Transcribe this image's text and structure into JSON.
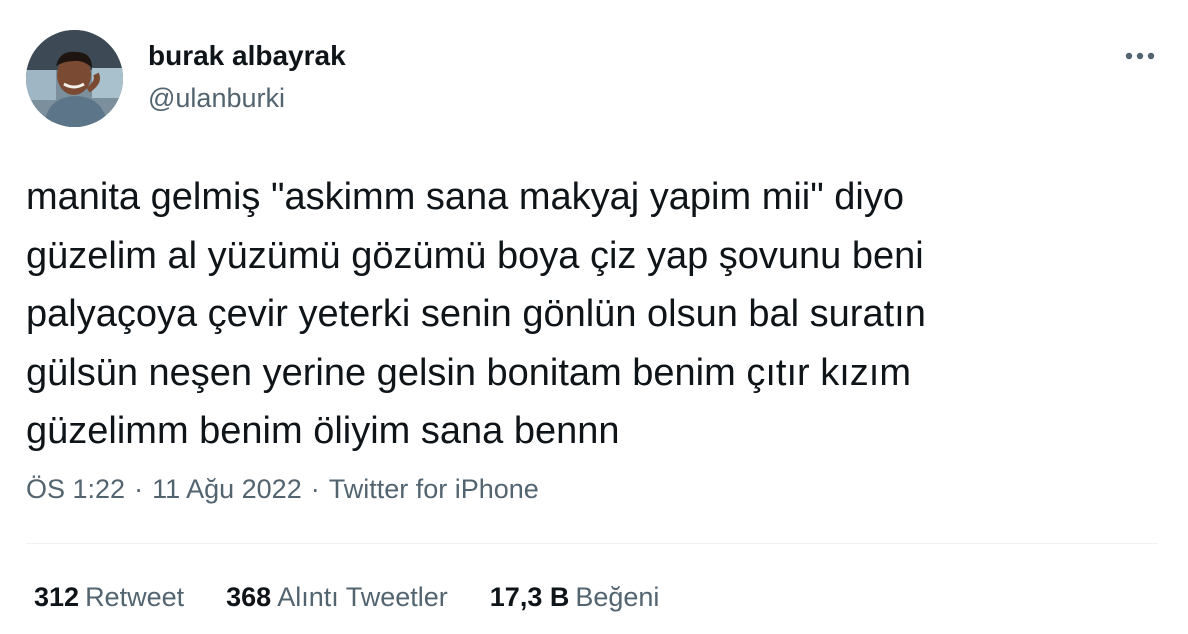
{
  "user": {
    "display_name": "burak albayrak",
    "handle": "@ulanburki"
  },
  "tweet": {
    "text": "manita gelmiş \"askimm sana makyaj yapim mii\" diyo\ngüzelim al yüzümü gözümü boya çiz yap şovunu beni\npalyaçoya çevir yeterki senin gönlün olsun bal suratın\ngülsün neşen yerine gelsin bonitam benim çıtır kızım\ngüzelimm benim öliyim sana bennn",
    "time": "ÖS 1:22",
    "date": "11 Ağu 2022",
    "separator": "·",
    "source": "Twitter for iPhone"
  },
  "stats": {
    "retweets": {
      "count": "312",
      "label": "Retweet"
    },
    "quotes": {
      "count": "368",
      "label": "Alıntı Tweetler"
    },
    "likes": {
      "count": "17,3 B",
      "label": "Beğeni"
    }
  },
  "icons": {
    "more": "more-dots-icon"
  },
  "colors": {
    "text_primary": "#0f1419",
    "text_secondary": "#536471",
    "divider": "#eff3f4"
  }
}
